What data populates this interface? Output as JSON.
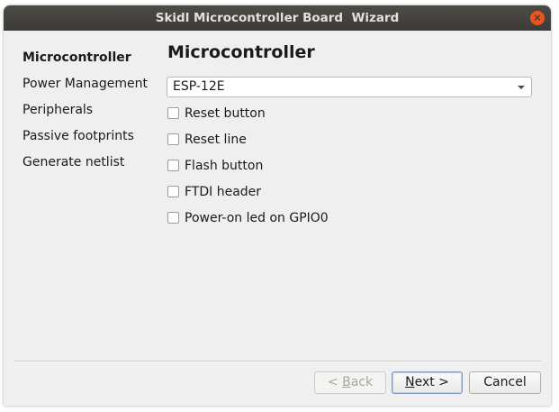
{
  "window": {
    "title": "Skidl Microcontroller Board  Wizard",
    "close_glyph": "×"
  },
  "sidebar": {
    "items": [
      {
        "label": "Microcontroller",
        "active": true
      },
      {
        "label": "Power Management",
        "active": false
      },
      {
        "label": "Peripherals",
        "active": false
      },
      {
        "label": "Passive footprints",
        "active": false
      },
      {
        "label": "Generate netlist",
        "active": false
      }
    ]
  },
  "page": {
    "title": "Microcontroller",
    "microcontroller_select": {
      "value": "ESP-12E"
    },
    "options": [
      {
        "label": "Reset button",
        "checked": false
      },
      {
        "label": "Reset line",
        "checked": false
      },
      {
        "label": "Flash button",
        "checked": false
      },
      {
        "label": "FTDI header",
        "checked": false
      },
      {
        "label": "Power-on led on GPIO0",
        "checked": false
      }
    ]
  },
  "buttons": {
    "back": {
      "prefix": "< ",
      "mnemonic": "B",
      "rest": "ack",
      "enabled": false
    },
    "next": {
      "mnemonic": "N",
      "rest": "ext >",
      "enabled": true
    },
    "cancel": {
      "label": "Cancel",
      "enabled": true
    }
  },
  "colors": {
    "titlebar": "#3d3b37",
    "close_button": "#e95420",
    "window_background": "#efefef"
  }
}
